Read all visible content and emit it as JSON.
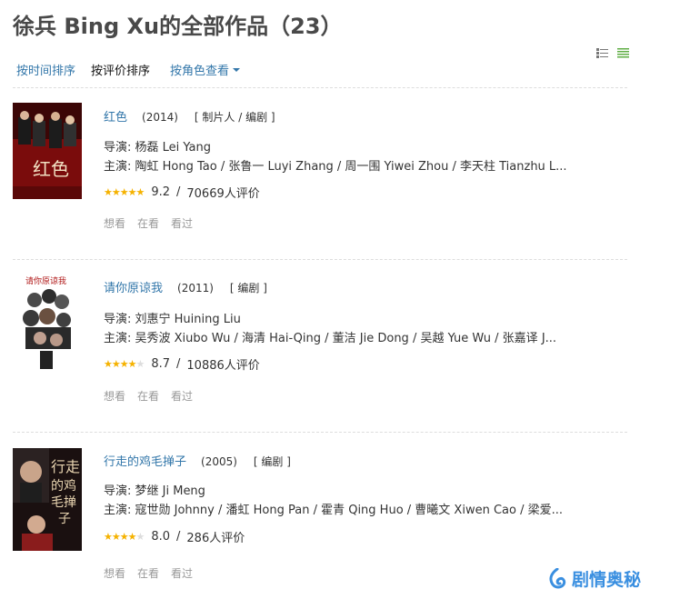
{
  "page": {
    "title": "徐兵 Bing Xu的全部作品（23）"
  },
  "sort": {
    "by_time": "按时间排序",
    "by_rating": "按评价排序",
    "by_role": "按角色查看"
  },
  "works": [
    {
      "title": "红色",
      "year": "(2014)",
      "roles": "[ 制片人 / 编剧 ]",
      "director": "导演: 杨磊 Lei Yang",
      "cast": "主演: 陶虹 Hong Tao / 张鲁一 Luyi Zhang / 周一围 Yiwei Zhou / 李天柱 Tianzhu L...",
      "score": "9.2",
      "score_value": 9.2,
      "votes": "70669人评价",
      "actions": [
        "想看",
        "在看",
        "看过"
      ]
    },
    {
      "title": "请你原谅我",
      "year": "(2011)",
      "roles": "[ 编剧 ]",
      "director": "导演: 刘惠宁 Huining Liu",
      "cast": "主演: 吴秀波 Xiubo Wu / 海清 Hai-Qing / 董洁 Jie Dong / 吴越 Yue Wu / 张嘉译 J...",
      "score": "8.7",
      "score_value": 8.7,
      "votes": "10886人评价",
      "actions": [
        "想看",
        "在看",
        "看过"
      ]
    },
    {
      "title": "行走的鸡毛掸子",
      "year": "(2005)",
      "roles": "[ 编剧 ]",
      "director": "导演: 梦继 Ji Meng",
      "cast": "主演: 寇世勋 Johnny / 潘虹 Hong Pan / 霍青 Qing Huo / 曹曦文 Xiwen Cao / 梁爱...",
      "score": "8.0",
      "score_value": 8.0,
      "votes": "286人评价",
      "actions": [
        "想看",
        "在看",
        "看过"
      ]
    }
  ],
  "watermark": {
    "text": "剧情奥秘"
  },
  "colors": {
    "link": "#3377aa",
    "star": "#f5b200",
    "watermark": "#3a8fe0"
  }
}
